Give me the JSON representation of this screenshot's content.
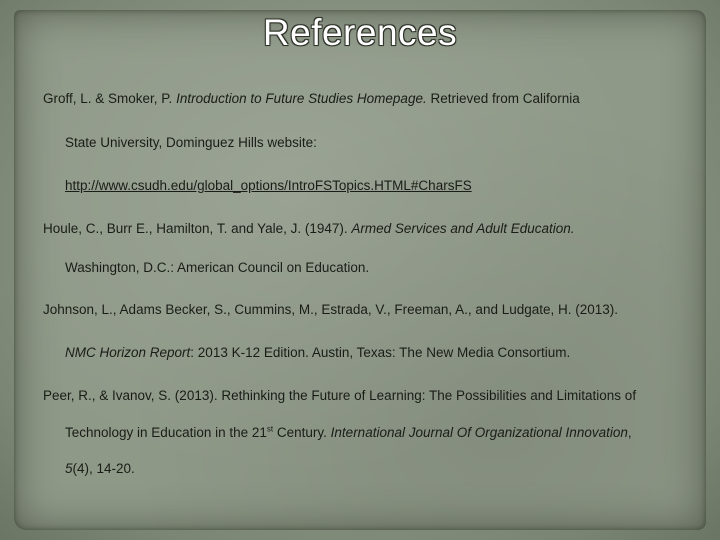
{
  "slide": {
    "title": "References",
    "references": [
      {
        "l1_a": "Groff, L. & Smoker, P. ",
        "l1_i": "Introduction to Future Studies Homepage.",
        "l1_b": " Retrieved from California",
        "l2": "State University, Dominguez Hills website:",
        "l3_link": "http://www.csudh.edu/global_options/IntroFSTopics.HTML#CharsFS"
      },
      {
        "l1_a": "Houle, C., Burr E., Hamilton, T. and Yale, J. (1947). ",
        "l1_i": "Armed Services and Adult Education.",
        "l2": "Washington, D.C.: American Council on Education."
      },
      {
        "l1": "Johnson, L., Adams Becker, S., Cummins, M., Estrada, V., Freeman, A., and Ludgate, H. (2013).",
        "l2_i": "NMC Horizon Report",
        "l2_b": ": 2013 K-12 Edition. Austin, Texas: The New Media Consortium."
      },
      {
        "l1": "Peer, R., & Ivanov, S. (2013). Rethinking the Future of Learning: The Possibilities and Limitations of",
        "l2_a": "Technology in Education in the 21",
        "l2_sup": "st",
        "l2_b": " Century. ",
        "l2_i": "International Journal Of Organizational Innovation",
        "l2_c": ",",
        "l3_i": "5",
        "l3_b": "(4), 14-20."
      }
    ]
  }
}
